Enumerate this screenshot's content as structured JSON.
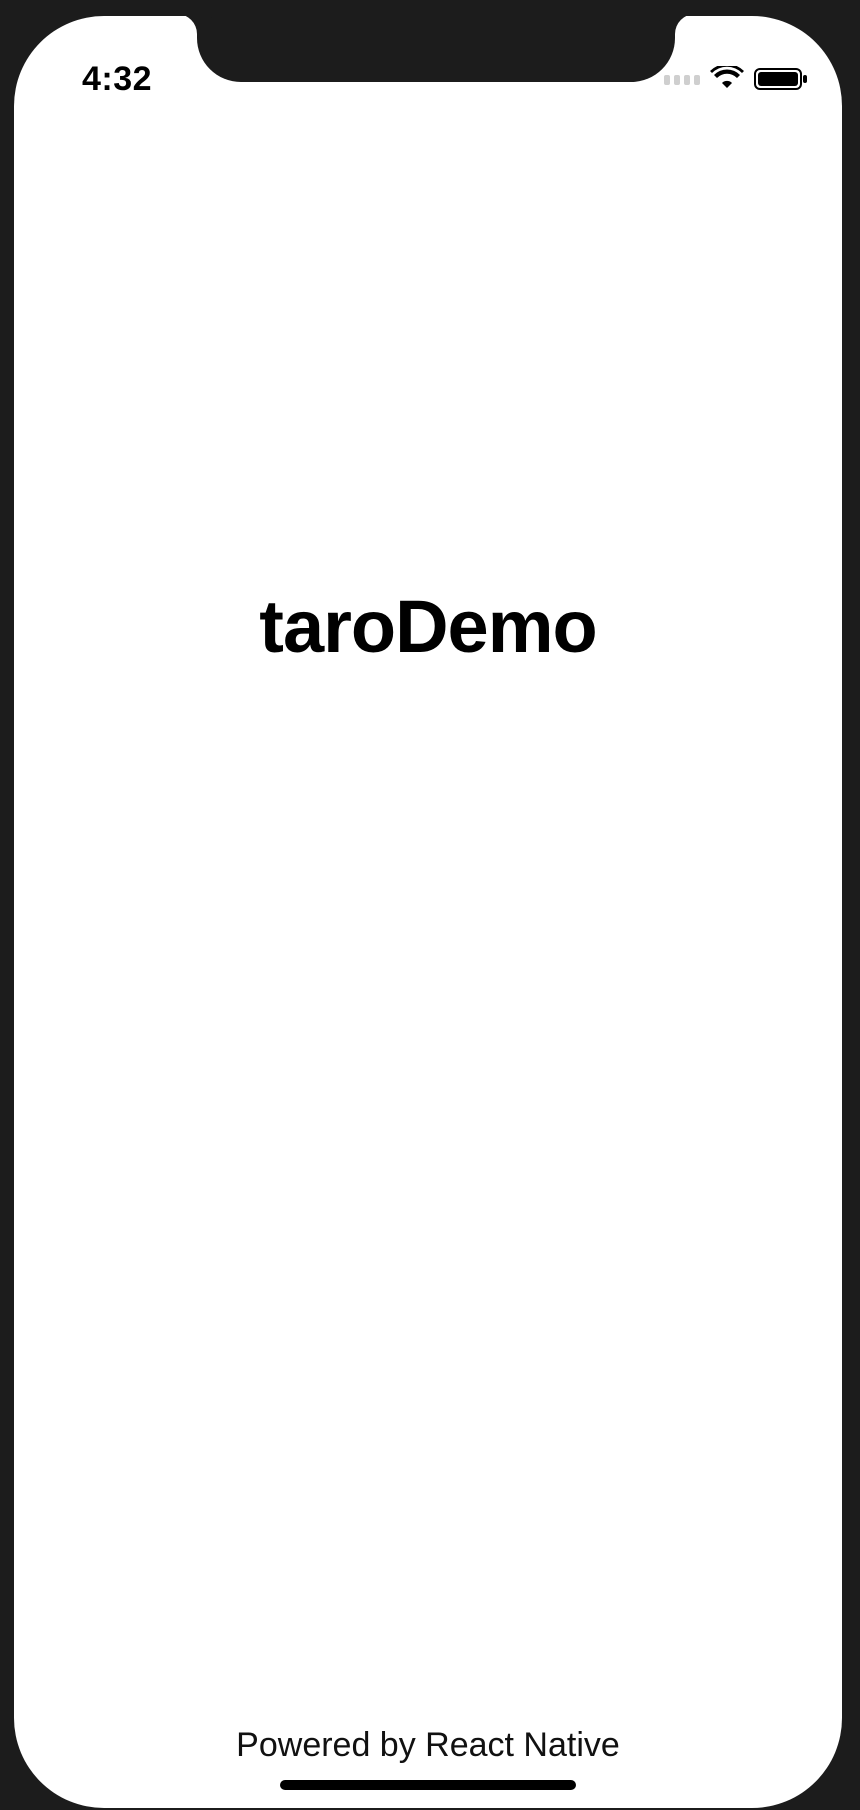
{
  "status_bar": {
    "time": "4:32",
    "signal_icon": "cellular-signal-icon",
    "wifi_icon": "wifi-icon",
    "battery_icon": "battery-icon"
  },
  "main": {
    "title": "taroDemo"
  },
  "footer": {
    "text": "Powered by React Native"
  },
  "colors": {
    "background": "#ffffff",
    "frame": "#1c1c1c",
    "text": "#000000"
  }
}
